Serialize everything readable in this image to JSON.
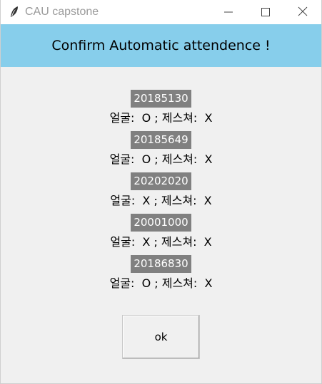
{
  "window": {
    "title": "CAU capstone",
    "icon": "feather-icon",
    "controls": [
      "minimize-icon",
      "maximize-icon",
      "close-icon"
    ]
  },
  "header": {
    "text": "Confirm Automatic attendence !",
    "background": "#87ceeb"
  },
  "entries": [
    {
      "id": "20185130",
      "status": "얼굴:  O ; 제스쳐:  X"
    },
    {
      "id": "20185649",
      "status": "얼굴:  O ; 제스쳐:  X"
    },
    {
      "id": "20202020",
      "status": "얼굴:  X ; 제스쳐:  X"
    },
    {
      "id": "20001000",
      "status": "얼굴:  X ; 제스쳐:  X"
    },
    {
      "id": "20186830",
      "status": "얼굴:  O ; 제스쳐:  X"
    }
  ],
  "ok_button": {
    "label": "ok"
  },
  "colors": {
    "id_badge": "#808080",
    "background": "#f0f0f0"
  }
}
